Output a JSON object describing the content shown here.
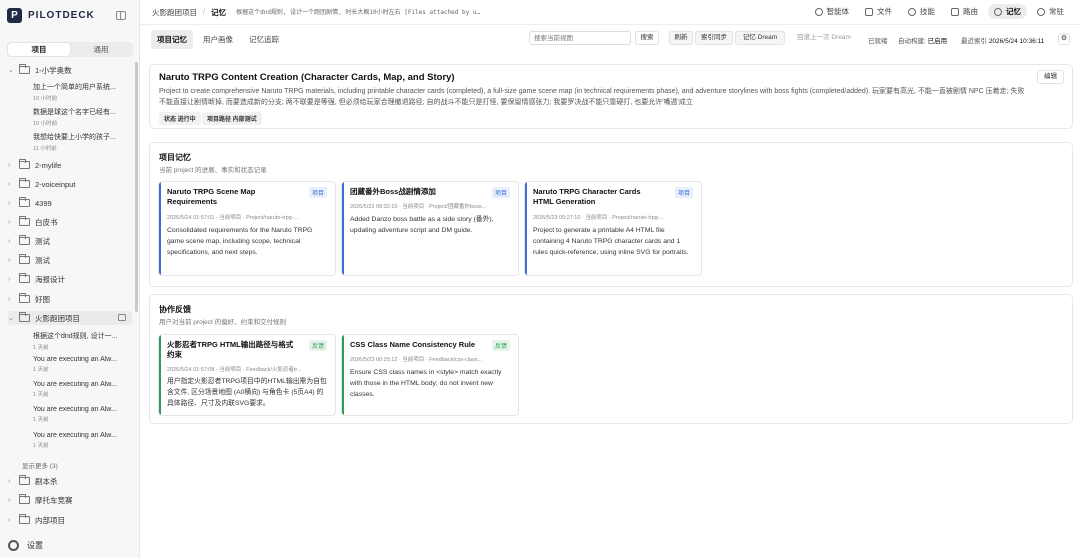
{
  "app": {
    "name": "PILOTDECK",
    "logo_letter": "P"
  },
  "sidebar": {
    "tabs": [
      "项目",
      "通用"
    ],
    "folders": [
      {
        "name": "1-小学奥数",
        "expanded": true,
        "sessions": [
          {
            "title": "加上一个简单的用户系统...",
            "time": "10 小时前"
          },
          {
            "title": "数据是球这个名字已经有...",
            "time": "10 小时前"
          },
          {
            "title": "我想给快要上小学的孩子...",
            "time": "11 小时前"
          }
        ]
      },
      {
        "name": "2-mylife"
      },
      {
        "name": "2-voiceinput"
      },
      {
        "name": "4399"
      },
      {
        "name": "白皮书"
      },
      {
        "name": "测试"
      },
      {
        "name": "测试"
      },
      {
        "name": "海报设计"
      },
      {
        "name": "好图"
      },
      {
        "name": "火影跑团项目",
        "expanded": true,
        "active": true,
        "sessions": [
          {
            "title": "根据这个dnd规则, 设计一...",
            "time": "1 天前"
          },
          {
            "title": "You are executing an Alw...",
            "time": "1 天前"
          },
          {
            "title": "You are executing an Alw...",
            "time": "1 天前"
          },
          {
            "title": "You are executing an Alw...",
            "time": "1 天前"
          },
          {
            "title": "You are executing an Alw...",
            "time": "1 天前"
          }
        ],
        "show_more": "显示更多 (3)"
      },
      {
        "name": "剧本杀"
      },
      {
        "name": "摩托车竞赛"
      },
      {
        "name": "内部项目"
      }
    ],
    "settings_label": "设置"
  },
  "header": {
    "crumb_project": "火影跑团项目",
    "crumb_current": "记忆",
    "crumb_desc": "根据这个dnd规则, 设计一个跑团剧情, 时长大概10小时左右 [Files attached by u…",
    "nav": [
      "智能体",
      "文件",
      "技能",
      "路由",
      "记忆",
      "常驻"
    ]
  },
  "toolbar": {
    "tabs": [
      "项目记忆",
      "用户画像",
      "记忆追踪"
    ],
    "search_placeholder": "搜索当前视图",
    "search_btn": "搜索",
    "refresh": "刷新",
    "sync": "索引同步",
    "dream": "记忆 Dream",
    "rollback": "回滚上一次 Dream",
    "status_ready": "已就绪",
    "auto_label": "自动构建:",
    "auto_value": "已启用",
    "last_index_label": "最近索引",
    "last_index_value": "2026/5/24 10:36:11"
  },
  "project": {
    "title": "Naruto TRPG Content Creation (Character Cards, Map, and Story)",
    "desc": "Project to create comprehensive Naruto TRPG materials, including printable character cards (completed), a full-size game scene map (in technical requirements phase), and adventure storylines with boss fights (completed/added). 玩家要有高光, 不能一直被剧情 NPC 压着走; 失败不能直接让剧情断掉, 而要造成新的分支; 两不联要是等强, 但必须给玩家合理撤退路径; 自的战斗不能只是打怪, 要保留情感张力; 我要罗决战不能只靠硬打, 也要允许'嘴遁'成立",
    "edit": "编辑",
    "chips": [
      "状态 进行中",
      "项目路径 内部测试"
    ]
  },
  "memories": {
    "title": "项目记忆",
    "subtitle": "当前 project 的进展、事实和状态记录",
    "cards": [
      {
        "title": "Naruto TRPG Scene Map Requirements",
        "tag": "项目",
        "meta": "2026/5/24 01:57:01 · 当前项目 · Project/naruto-trpg-...",
        "body": "Consolidated requirements for the Naruto TRPG game scene map, including scope, technical specifications, and next steps."
      },
      {
        "title": "团藏番外Boss战剧情添加",
        "tag": "项目",
        "meta": "2026/5/23 09:32:10 · 当前项目 · Project/团藏番外boss...",
        "body": "Added Danzo boss battle as a side story (番外), updating adventure script and DM guide."
      },
      {
        "title": "Naruto TRPG Character Cards HTML Generation",
        "tag": "项目",
        "meta": "2026/5/23 00:27:10 · 当前项目 · Project/naruto-trpg-...",
        "body": "Project to generate a printable A4 HTML file containing 4 Naruto TRPG character cards and 1 rules quick-reference, using inline SVG for portraits."
      }
    ]
  },
  "feedback": {
    "title": "协作反馈",
    "subtitle": "用户对当前 project 的偏好、约束和交付规则",
    "cards": [
      {
        "title": "火影忍者TRPG HTML输出路径与格式约束",
        "tag": "反馈",
        "meta": "2026/5/24 01:57:08 · 当前项目 · Feedback/火影忍者tr...",
        "body": "用户指定火影忍者TRPG项目中的HTML输出需为自包含文件, 区分场景地图 (A0横向) 与角色卡 (5页A4) 的具体路径、尺寸及内联SVG要求。"
      },
      {
        "title": "CSS Class Name Consistency Rule",
        "tag": "反馈",
        "meta": "2026/5/23 00:25:12 · 当前项目 · Feedback/css-class...",
        "body": "Ensure CSS class names in <style> match exactly with those in the HTML body; do not invent new classes."
      }
    ]
  },
  "colors": {
    "accent_blue": "#3b6fd6",
    "accent_green": "#2e9a55",
    "brand": "#1f2a44"
  }
}
